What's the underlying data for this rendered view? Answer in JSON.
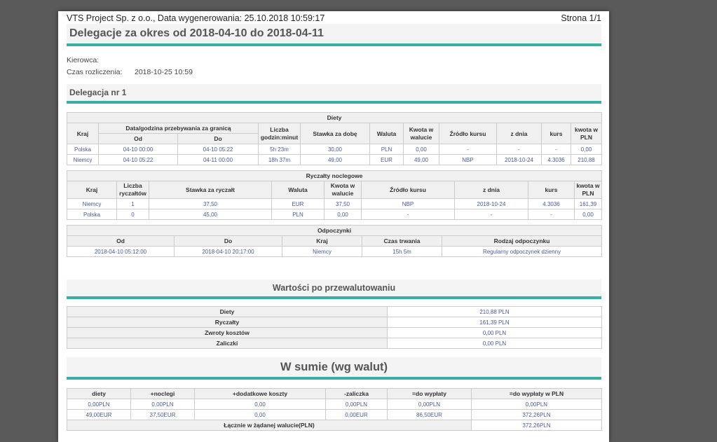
{
  "header": {
    "left": "VTS Project Sp. z o.o., Data wygenerowania: 25.10.2018 10:59:17",
    "right": "Strona 1/1"
  },
  "title": "Delegacje za okres od 2018-04-10 do 2018-04-11",
  "meta": {
    "driver_label": "Kierowca:",
    "settle_label": "Czas rozliczenia:",
    "settle_value": "2018-10-25 10:59"
  },
  "section_title": "Delegacja nr 1",
  "diety": {
    "caption": "Diety",
    "h_kraj": "Kraj",
    "h_group": "Data/godzina przebywania za granicą",
    "h_od": "Od",
    "h_do": "Do",
    "h_liczba": "Liczba godzin:minut",
    "h_stawka": "Stawka za dobę",
    "h_waluta": "Waluta",
    "h_kwota": "Kwota w walucie",
    "h_zrodlo": "Źródło kursu",
    "h_zdnia": "z dnia",
    "h_kurs": "kurs",
    "h_pln": "kwota w PLN",
    "rows": [
      [
        "Polska",
        "04-10 00:00",
        "04-10 05:22",
        "5h 23m",
        "30,00",
        "PLN",
        "0,00",
        "-",
        "-",
        "-",
        "0,00"
      ],
      [
        "Niemcy",
        "04-10 05:22",
        "04-11 00:00",
        "18h 37m",
        "49,00",
        "EUR",
        "49,00",
        "NBP",
        "2018-10-24",
        "4.3036",
        "210,88"
      ]
    ]
  },
  "ryczalty": {
    "caption": "Ryczałty noclegowe",
    "headers": [
      "Kraj",
      "Liczba ryczałtów",
      "Stawka za ryczałt",
      "Waluta",
      "Kwota w walucie",
      "Źródło kursu",
      "z dnia",
      "kurs",
      "kwota w PLN"
    ],
    "rows": [
      [
        "Niemcy",
        "1",
        "37,50",
        "EUR",
        "37,50",
        "NBP",
        "2018-10-24",
        "4.3036",
        "161,39"
      ],
      [
        "Polska",
        "0",
        "45,00",
        "PLN",
        "0,00",
        "-",
        "-",
        "-",
        "0,00"
      ]
    ]
  },
  "odpoczynki": {
    "caption": "Odpoczynki",
    "headers": [
      "Od",
      "Do",
      "Kraj",
      "Czas trwania",
      "Rodzaj odpoczynku"
    ],
    "rows": [
      [
        "2018-04-10 05:12:00",
        "2018-04-10 20:17:00",
        "Niemcy",
        "15h 5m",
        "Regularny odpoczynek dzienny"
      ]
    ]
  },
  "wartosci": {
    "title": "Wartości po przewalutowaniu",
    "rows": [
      [
        "Diety",
        "210,88 PLN"
      ],
      [
        "Ryczałty",
        "161,39 PLN"
      ],
      [
        "Zwroty kosztów",
        "0,00 PLN"
      ],
      [
        "Zaliczki",
        "0,00 PLN"
      ]
    ]
  },
  "suma": {
    "title": "W sumie (wg walut)",
    "headers": [
      "diety",
      "+noclegi",
      "+dodatkowe koszty",
      "-zaliczka",
      "=do wypłaty",
      "=do wypłaty w PLN"
    ],
    "rows": [
      [
        "0,00PLN",
        "0,00PLN",
        "0,00",
        "0,00PLN",
        "0,00PLN",
        "0,00PLN"
      ],
      [
        "49,00EUR",
        "37,50EUR",
        "0,00",
        "0,00EUR",
        "86,50EUR",
        "372,26PLN"
      ]
    ],
    "total_label": "Łącznie w żądanej walucie(PLN)",
    "total_value": "372,26PLN"
  },
  "colors": {
    "accent": "#3aaea5",
    "cell_text": "#4a5a9c",
    "header_bg": "#f0f0f0"
  }
}
